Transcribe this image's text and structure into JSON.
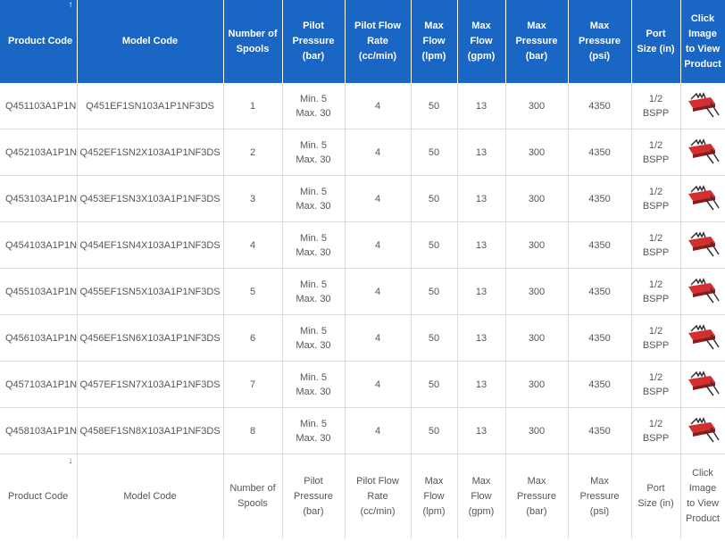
{
  "headers": [
    [
      "Product Code"
    ],
    [
      "Model Code"
    ],
    [
      "Number of",
      "Spools"
    ],
    [
      "Pilot",
      "Pressure",
      "(bar)"
    ],
    [
      "Pilot Flow",
      "Rate",
      "(cc/min)"
    ],
    [
      "Max",
      "Flow",
      "(lpm)"
    ],
    [
      "Max",
      "Flow",
      "(gpm)"
    ],
    [
      "Max",
      "Pressure",
      "(bar)"
    ],
    [
      "Max",
      "Pressure",
      "(psi)"
    ],
    [
      "Port",
      "Size (in)"
    ],
    [
      "Click",
      "Image",
      "to View",
      "Product"
    ]
  ],
  "sort_icons": {
    "up": "↑",
    "down": "↓"
  },
  "icons": {
    "sort_up": "arrow-up-icon",
    "sort_down": "arrow-down-icon",
    "product": "valve-product-icon"
  },
  "colors": {
    "header_bg": "#1a66c5",
    "header_text": "#ffffff",
    "cell_text": "#555555",
    "product_red": "#d32f2f"
  },
  "rows": [
    {
      "product_code": "Q451103A1P1N",
      "model_code": "Q451EF1SN103A1P1NF3DS",
      "spools": "1",
      "pilot_pressure": [
        "Min. 5",
        "Max. 30"
      ],
      "pilot_flow": "4",
      "flow_lpm": "50",
      "flow_gpm": "13",
      "pressure_bar": "300",
      "pressure_psi": "4350",
      "port_size": [
        "1/2",
        "BSPP"
      ]
    },
    {
      "product_code": "Q452103A1P1N",
      "model_code": "Q452EF1SN2X103A1P1NF3DS",
      "spools": "2",
      "pilot_pressure": [
        "Min. 5",
        "Max. 30"
      ],
      "pilot_flow": "4",
      "flow_lpm": "50",
      "flow_gpm": "13",
      "pressure_bar": "300",
      "pressure_psi": "4350",
      "port_size": [
        "1/2",
        "BSPP"
      ]
    },
    {
      "product_code": "Q453103A1P1N",
      "model_code": "Q453EF1SN3X103A1P1NF3DS",
      "spools": "3",
      "pilot_pressure": [
        "Min. 5",
        "Max. 30"
      ],
      "pilot_flow": "4",
      "flow_lpm": "50",
      "flow_gpm": "13",
      "pressure_bar": "300",
      "pressure_psi": "4350",
      "port_size": [
        "1/2",
        "BSPP"
      ]
    },
    {
      "product_code": "Q454103A1P1N",
      "model_code": "Q454EF1SN4X103A1P1NF3DS",
      "spools": "4",
      "pilot_pressure": [
        "Min. 5",
        "Max. 30"
      ],
      "pilot_flow": "4",
      "flow_lpm": "50",
      "flow_gpm": "13",
      "pressure_bar": "300",
      "pressure_psi": "4350",
      "port_size": [
        "1/2",
        "BSPP"
      ]
    },
    {
      "product_code": "Q455103A1P1N",
      "model_code": "Q455EF1SN5X103A1P1NF3DS",
      "spools": "5",
      "pilot_pressure": [
        "Min. 5",
        "Max. 30"
      ],
      "pilot_flow": "4",
      "flow_lpm": "50",
      "flow_gpm": "13",
      "pressure_bar": "300",
      "pressure_psi": "4350",
      "port_size": [
        "1/2",
        "BSPP"
      ]
    },
    {
      "product_code": "Q456103A1P1N",
      "model_code": "Q456EF1SN6X103A1P1NF3DS",
      "spools": "6",
      "pilot_pressure": [
        "Min. 5",
        "Max. 30"
      ],
      "pilot_flow": "4",
      "flow_lpm": "50",
      "flow_gpm": "13",
      "pressure_bar": "300",
      "pressure_psi": "4350",
      "port_size": [
        "1/2",
        "BSPP"
      ]
    },
    {
      "product_code": "Q457103A1P1N",
      "model_code": "Q457EF1SN7X103A1P1NF3DS",
      "spools": "7",
      "pilot_pressure": [
        "Min. 5",
        "Max. 30"
      ],
      "pilot_flow": "4",
      "flow_lpm": "50",
      "flow_gpm": "13",
      "pressure_bar": "300",
      "pressure_psi": "4350",
      "port_size": [
        "1/2",
        "BSPP"
      ]
    },
    {
      "product_code": "Q458103A1P1N",
      "model_code": "Q458EF1SN8X103A1P1NF3DS",
      "spools": "8",
      "pilot_pressure": [
        "Min. 5",
        "Max. 30"
      ],
      "pilot_flow": "4",
      "flow_lpm": "50",
      "flow_gpm": "13",
      "pressure_bar": "300",
      "pressure_psi": "4350",
      "port_size": [
        "1/2",
        "BSPP"
      ]
    }
  ]
}
